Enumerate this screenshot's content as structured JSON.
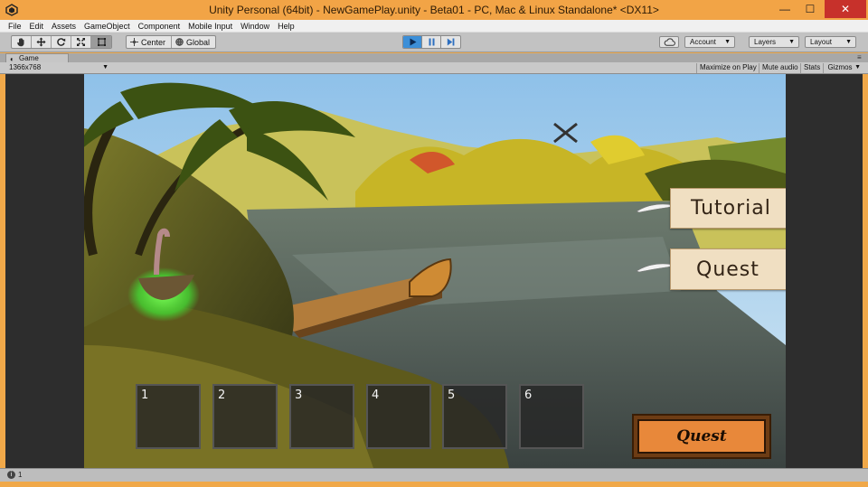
{
  "window": {
    "title": "Unity Personal (64bit) - NewGamePlay.unity - Beta01 - PC, Mac & Linux Standalone* <DX11>",
    "minimize": "—",
    "maximize": "☐",
    "close": "✕"
  },
  "menu": [
    "File",
    "Edit",
    "Assets",
    "GameObject",
    "Component",
    "Mobile Input",
    "Window",
    "Help"
  ],
  "toolbar": {
    "pivot_center": "Center",
    "pivot_global": "Global",
    "account": "Account",
    "layers": "Layers",
    "layout": "Layout"
  },
  "game_tab": {
    "label": "Game",
    "resolution": "1366x768",
    "maximize_on_play": "Maximize on Play",
    "mute_audio": "Mute audio",
    "stats": "Stats",
    "gizmos": "Gizmos"
  },
  "game_ui": {
    "tutorial_label": "Tutorial",
    "quest_side_label": "Quest",
    "quest_button_label": "Quest",
    "slots": [
      "1",
      "2",
      "3",
      "4",
      "5",
      "6"
    ]
  },
  "status": {
    "text": "1"
  },
  "colors": {
    "titlebar": "#f2a446",
    "play_active": "#3c8fd8",
    "quest_button": "#e8883a",
    "menu_button_paper": "#f0dfc2"
  }
}
